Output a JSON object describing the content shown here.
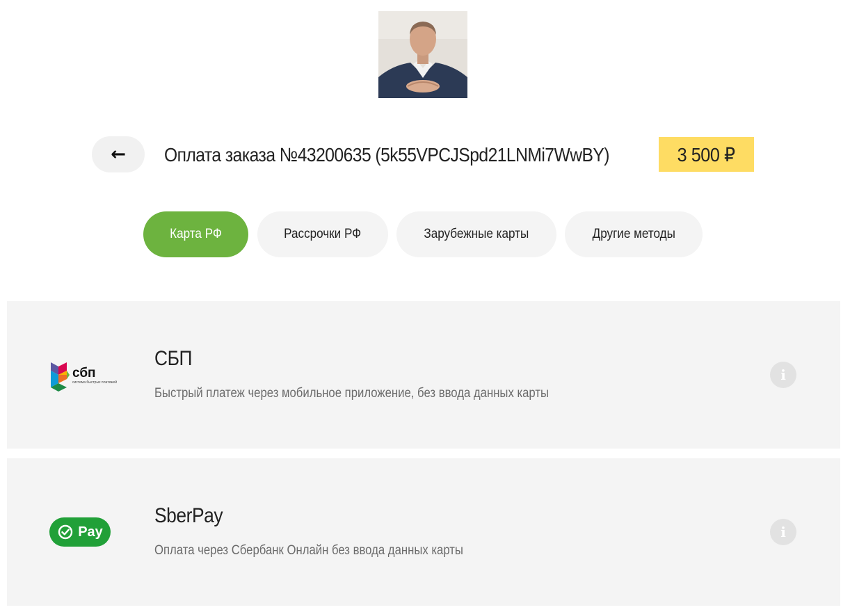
{
  "header": {
    "back_arrow": "←",
    "order_title": "Оплата заказа №43200635 (5k55VPCJSpd21LNMi7WwBY)",
    "price": "3 500 ₽"
  },
  "tabs": [
    {
      "label": "Карта РФ",
      "active": true
    },
    {
      "label": "Рассрочки РФ",
      "active": false
    },
    {
      "label": "Зарубежные карты",
      "active": false
    },
    {
      "label": "Другие методы",
      "active": false
    }
  ],
  "methods": [
    {
      "name": "СБП",
      "description": "Быстрый платеж через мобильное приложение, без ввода данных карты",
      "logo_text": "сбп",
      "logo_subtext": "система быстрых платежей",
      "info_glyph": "i"
    },
    {
      "name": "SberPay",
      "description": "Оплата через Сбербанк Онлайн без ввода данных карты",
      "logo_text": "Pay",
      "info_glyph": "i"
    }
  ],
  "colors": {
    "accent_green": "#6db33f",
    "price_yellow": "#fedc63",
    "card_bg": "#f4f4f4",
    "sber_green": "#21a038"
  }
}
